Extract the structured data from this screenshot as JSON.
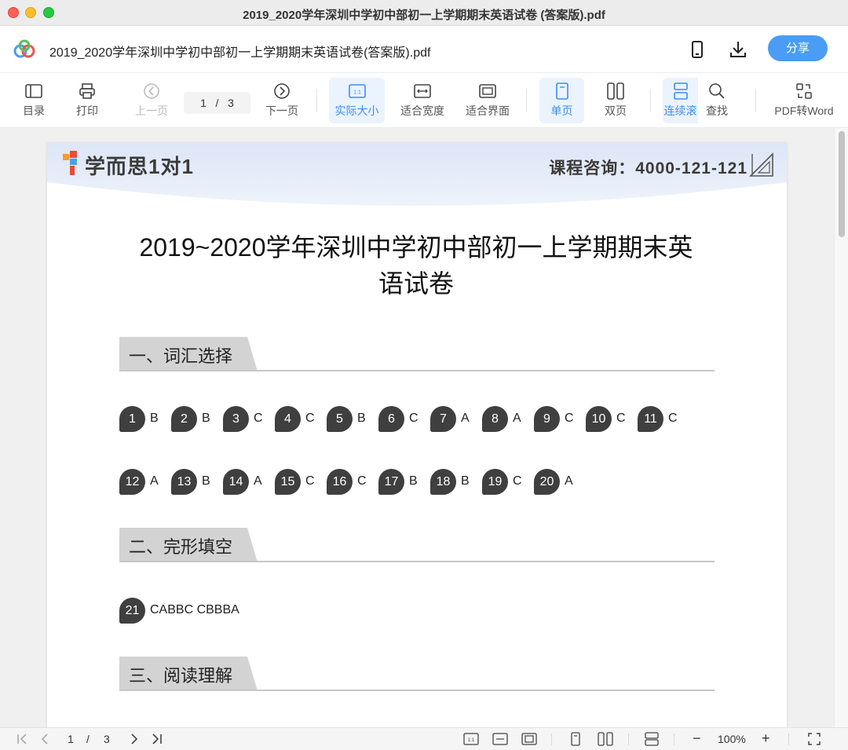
{
  "window": {
    "title": "2019_2020学年深圳中学初中部初一上学期期末英语试卷 (答案版).pdf"
  },
  "header": {
    "file_name": "2019_2020学年深圳中学初中部初一上学期期末英语试卷(答案版).pdf",
    "share_label": "分享",
    "icons": [
      "app-logo",
      "phone-icon",
      "download-icon"
    ]
  },
  "toolbar": {
    "toc": "目录",
    "print": "打印",
    "prev": "上一页",
    "page_current": "1",
    "page_sep": "/",
    "page_total": "3",
    "next": "下一页",
    "actual_size": "实际大小",
    "fit_width": "适合宽度",
    "fit_page": "适合界面",
    "single_page": "单页",
    "double_page": "双页",
    "continuous": "连续滚",
    "find": "查找",
    "pdf_to_word": "PDF转Word",
    "active_color": "#3d8ef0"
  },
  "document": {
    "brand": "学而思1对1",
    "consult": "课程咨询：4000-121-121",
    "title_line1": "2019~2020学年深圳中学初中部初一上学期期末英",
    "title_line2": "语试卷",
    "sections": [
      {
        "title": "一、词汇选择"
      },
      {
        "title": "二、完形填空"
      },
      {
        "title": "三、阅读理解"
      }
    ],
    "answers_row1": [
      {
        "n": "1",
        "a": "B"
      },
      {
        "n": "2",
        "a": "B"
      },
      {
        "n": "3",
        "a": "C"
      },
      {
        "n": "4",
        "a": "C"
      },
      {
        "n": "5",
        "a": "B"
      },
      {
        "n": "6",
        "a": "C"
      },
      {
        "n": "7",
        "a": "A"
      },
      {
        "n": "8",
        "a": "A"
      },
      {
        "n": "9",
        "a": "C"
      },
      {
        "n": "10",
        "a": "C"
      },
      {
        "n": "11",
        "a": "C"
      }
    ],
    "answers_row2": [
      {
        "n": "12",
        "a": "A"
      },
      {
        "n": "13",
        "a": "B"
      },
      {
        "n": "14",
        "a": "A"
      },
      {
        "n": "15",
        "a": "C"
      },
      {
        "n": "16",
        "a": "C"
      },
      {
        "n": "17",
        "a": "B"
      },
      {
        "n": "18",
        "a": "B"
      },
      {
        "n": "19",
        "a": "C"
      },
      {
        "n": "20",
        "a": "A"
      }
    ],
    "cloze": {
      "n": "21",
      "a": "CABBC  CBBBA"
    }
  },
  "statusbar": {
    "page_current": "1",
    "page_sep": "/",
    "page_total": "3",
    "zoom": "100%",
    "zoom_minus": "−",
    "zoom_plus": "+"
  }
}
